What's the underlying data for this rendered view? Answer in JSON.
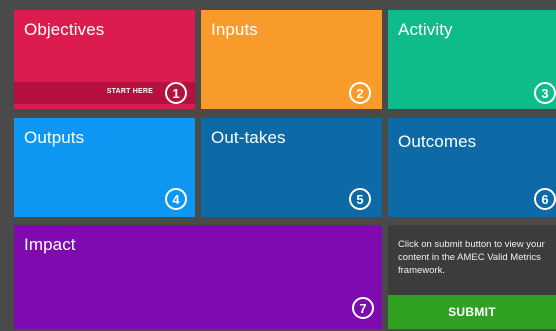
{
  "tiles": [
    {
      "label": "Objectives",
      "number": "1",
      "color": "#dc1b4e"
    },
    {
      "label": "Inputs",
      "number": "2",
      "color": "#f99b2b"
    },
    {
      "label": "Activity",
      "number": "3",
      "color": "#0dbc8a"
    },
    {
      "label": "Outputs",
      "number": "4",
      "color": "#0e97f2"
    },
    {
      "label": "Out-takes",
      "number": "5",
      "color": "#0d6aa6"
    },
    {
      "label": "Outcomes",
      "number": "6",
      "color": "#0d6aa6"
    },
    {
      "label": "Impact",
      "number": "7",
      "color": "#7f0ab0"
    }
  ],
  "start_here": "START HERE",
  "submit": {
    "instruction": "Click on submit button to view your content in the AMEC Valid Metrics framework.",
    "button_label": "SUBMIT",
    "button_color": "#2fa022"
  }
}
